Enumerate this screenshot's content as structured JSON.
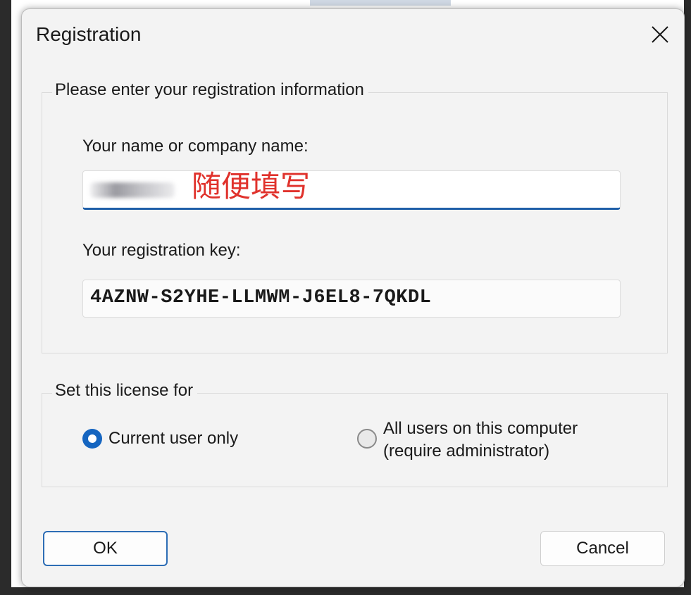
{
  "window": {
    "title": "Registration",
    "close_icon": "close-icon"
  },
  "registration_group": {
    "legend": "Please enter your registration information",
    "name_label": "Your name or company name:",
    "name_value_annotation": "随便填写",
    "key_label": "Your registration key:",
    "key_value": "4AZNW-S2YHE-LLMWM-J6EL8-7QKDL"
  },
  "license_group": {
    "legend": "Set this license for",
    "options": [
      {
        "label": "Current user only",
        "selected": true
      },
      {
        "label_line1": "All users on this computer",
        "label_line2": "(require administrator)",
        "selected": false
      }
    ]
  },
  "buttons": {
    "ok": "OK",
    "cancel": "Cancel"
  },
  "colors": {
    "accent": "#1565c0",
    "annotation": "#e0322c",
    "dialog_bg": "#f3f3f3"
  }
}
